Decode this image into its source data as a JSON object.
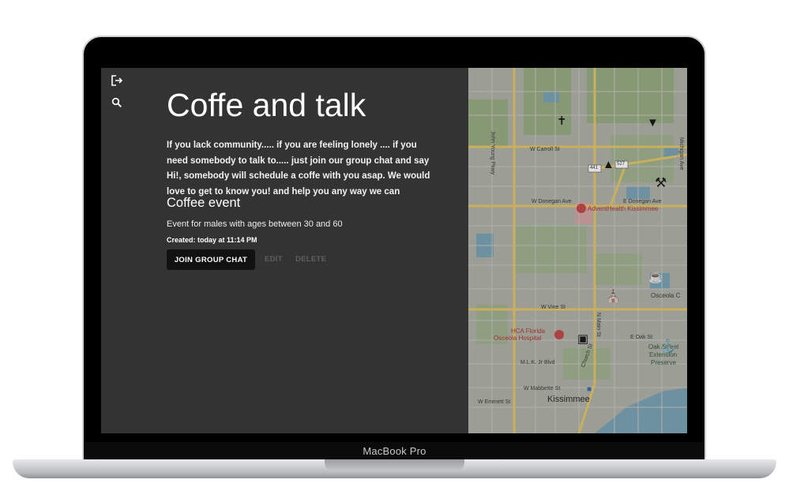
{
  "device": {
    "brand_label": "MacBook Pro"
  },
  "app": {
    "title": "Coffe and talk",
    "description": "If you lack community..... if you are feeling lonely .... if you need somebody to talk to..... just join our group chat and say Hi!, somebody will schedule a coffe with you asap. We would love to get to know you! and help you any way we can",
    "event": {
      "title": "Coffee event",
      "description": "Event for males with ages between 30 and 60",
      "created": "Created: today at 11:14 PM"
    },
    "buttons": {
      "join": "JOIN GROUP CHAT",
      "edit": "EDIT",
      "delete": "DELETE"
    },
    "sidebar": {
      "icons": [
        "logout-icon",
        "search-icon"
      ]
    }
  },
  "map": {
    "labels": {
      "carroll": "W Carroll St",
      "donegan_w": "W Donegan Ave",
      "donegan_e": "E Donegan Ave",
      "vine": "W Vine St",
      "oak": "E Oak St",
      "mlk": "M.L.K. Jr Blvd",
      "mabbette": "W Mabbette St",
      "emmett": "W Emmett St",
      "john_young": "John Young Pkwy",
      "church": "Church St",
      "main": "N Main St",
      "michigan": "Michigan Ave",
      "kissimmee": "Kissimmee",
      "adventhealth": "AdventHealth Kissimmee",
      "hca_line1": "HCA Florida",
      "hca_line2": "Osceola Hospital",
      "osceola": "Osceola C",
      "preserve_1": "Oak Street",
      "preserve_2": "Extension",
      "preserve_3": "Preserve",
      "shield_441": "441",
      "shield_527": "527"
    },
    "colors": {
      "road_major": "#e6c86a",
      "water": "#7ea5b8",
      "park": "#9aae86",
      "pin": "#c64a4a"
    }
  }
}
